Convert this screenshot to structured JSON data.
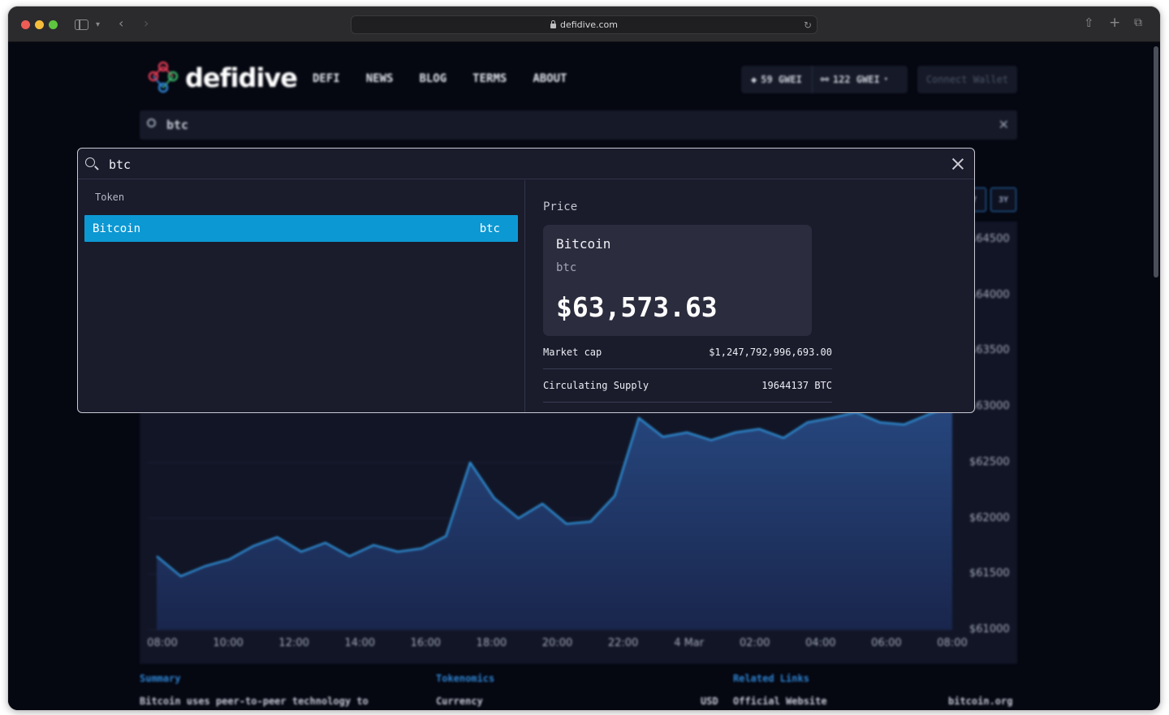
{
  "browser": {
    "url": "defidive.com"
  },
  "site": {
    "logo_text": "defidive",
    "nav": [
      "DEFI",
      "NEWS",
      "BLOG",
      "TERMS",
      "ABOUT"
    ],
    "gas_eth": "59 GWEI",
    "gas_other": "122 GWEI",
    "connect_label": "Connect Wallet",
    "search_value": "btc",
    "range_buttons": [
      "Y",
      "3Y"
    ]
  },
  "chart_data": {
    "type": "area",
    "title": "",
    "xlabel": "",
    "ylabel": "",
    "x": [
      "08:00",
      "10:00",
      "12:00",
      "14:00",
      "16:00",
      "18:00",
      "20:00",
      "22:00",
      "4 Mar",
      "02:00",
      "04:00",
      "06:00",
      "08:00"
    ],
    "y_ticks": [
      "$64500",
      "$64000",
      "$63500",
      "$63000",
      "$62500",
      "$62000",
      "$61500",
      "$61000"
    ],
    "ylim": [
      61000,
      64500
    ],
    "series": [
      {
        "name": "",
        "color": "#2e8fd6",
        "values": [
          61660,
          61480,
          61570,
          61630,
          61750,
          61830,
          61700,
          61780,
          61660,
          61760,
          61700,
          61730,
          61840,
          62500,
          62180,
          62000,
          62130,
          61950,
          61970,
          62200,
          62900,
          62730,
          62770,
          62700,
          62770,
          62800,
          62720,
          62860,
          62900,
          62950,
          62860,
          62840,
          62930,
          63010
        ]
      }
    ],
    "legend": "none",
    "grid": true
  },
  "footer": {
    "summary_head": "Summary",
    "summary_text": "Bitcoin uses peer-to-peer technology to",
    "tokenomics_head": "Tokenomics",
    "currency_label": "Currency",
    "currency_value": "USD",
    "links_head": "Related Links",
    "website_label": "Official Website",
    "website_value": "bitcoin.org"
  },
  "modal": {
    "query": "btc",
    "group_label": "Token",
    "result": {
      "name": "Bitcoin",
      "symbol": "btc"
    },
    "price_heading": "Price",
    "card": {
      "name": "Bitcoin",
      "symbol": "btc",
      "price": "$63,573.63"
    },
    "stats": [
      {
        "label": "Market cap",
        "value": "$1,247,792,996,693.00"
      },
      {
        "label": "Circulating Supply",
        "value": "19644137 BTC"
      }
    ]
  },
  "colors": {
    "accent": "#0c98d3",
    "chart_line": "#2e8fd6",
    "background": "#050711",
    "modal_bg": "#1a1b2b"
  }
}
